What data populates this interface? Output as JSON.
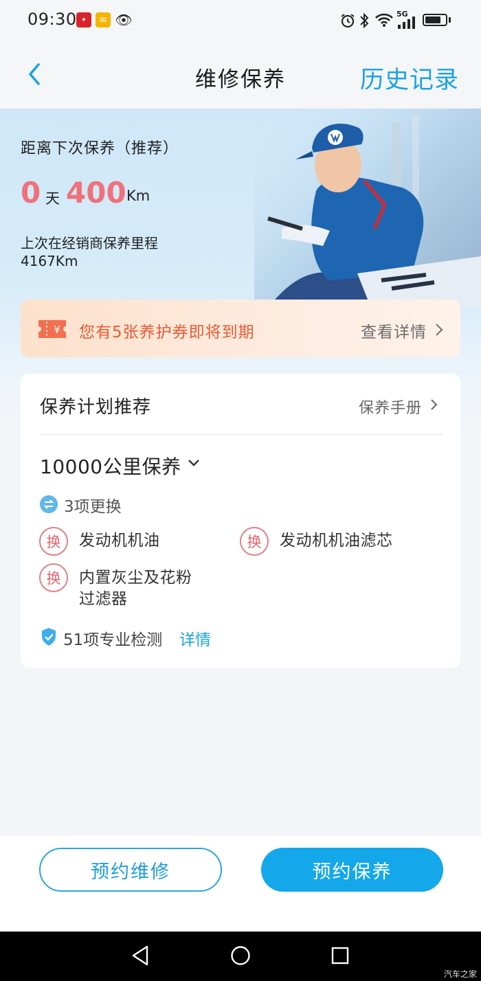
{
  "status_bar": {
    "time": "09:30",
    "network": "5G"
  },
  "header": {
    "title": "维修保养",
    "history": "历史记录"
  },
  "hero": {
    "next_label": "距离下次保养（推荐）",
    "days": "0",
    "days_unit": "天",
    "km": "400",
    "km_unit": "Km",
    "last_label": "上次在经销商保养里程",
    "last_value": "4167Km"
  },
  "coupon": {
    "text": "您有5张养护券即将到期",
    "link": "查看详情",
    "icon_symbol": "¥"
  },
  "plan": {
    "title": "保养计划推荐",
    "manual": "保养手册",
    "interval": "10000公里保养",
    "replace_count": "3项更换",
    "badge": "换",
    "items": [
      {
        "name": "发动机机油"
      },
      {
        "name": "发动机机油滤芯"
      },
      {
        "name": "内置灰尘及花粉过滤器"
      }
    ],
    "inspection": "51项专业检测",
    "detail": "详情"
  },
  "actions": {
    "repair": "预约维修",
    "maintenance": "预约保养"
  },
  "watermark": "汽车之家",
  "colors": {
    "accent": "#1aa3e4",
    "highlight": "#f0717a",
    "coupon_text": "#e95a35"
  }
}
